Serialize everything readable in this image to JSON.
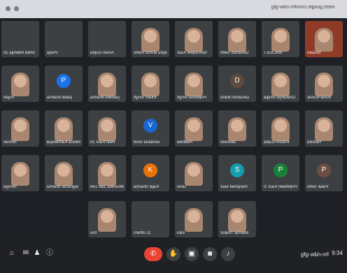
{
  "browser": {
    "url": "meet.google.com/fm-ridw-gfg"
  },
  "tiles": [
    {
      "name": "Ishita Makhija 10"
    },
    {
      "name": "Pooja"
    },
    {
      "name": "Aman Gupta"
    },
    {
      "name": "vipra arvind mehta"
    },
    {
      "name": "Simranjeet Kaur"
    },
    {
      "name": "Devanshi Sethi"
    },
    {
      "name": "BALJEET"
    },
    {
      "name": "Ishaani"
    },
    {
      "name": "Srijan"
    },
    {
      "name": "palak khanna"
    },
    {
      "name": "yashika sharma"
    },
    {
      "name": "Ekam Singh"
    },
    {
      "name": "Pratiksha Singh"
    },
    {
      "name": "Devanshi Batra"
    },
    {
      "name": "Chaitanya Singla"
    },
    {
      "name": "kunal Kumar"
    },
    {
      "name": "Simran"
    },
    {
      "name": "Meera Karthikeyan"
    },
    {
      "name": "Reet Kaur 23"
    },
    {
      "name": "vandana sood"
    },
    {
      "name": "Radhika"
    },
    {
      "name": "Jasmeet"
    },
    {
      "name": "Khushi Gupta"
    },
    {
      "name": "Yashika"
    },
    {
      "name": "Shreya"
    },
    {
      "name": "lagharne sharma"
    },
    {
      "name": "Bhumika Jain 144"
    },
    {
      "name": "Kajal Sharma"
    },
    {
      "name": "Tanvi"
    },
    {
      "name": "manpreet kaur"
    },
    {
      "name": "Prabhleen Kaur 104"
    },
    {
      "name": "Palak Sethi"
    },
    {
      "name": "You"
    },
    {
      "name": "11 others"
    },
    {
      "name": "Vani"
    },
    {
      "name": "Mannat Thakur"
    }
  ],
  "avatars": {
    "p": "P",
    "d": "D",
    "v": "V",
    "k": "K",
    "s": "S",
    "c": "P"
  },
  "bottom": {
    "meeting": "fm-ridw-gfg",
    "time": "9:34"
  },
  "colors": {
    "accent": "#1a73e8",
    "end": "#ea4335"
  }
}
